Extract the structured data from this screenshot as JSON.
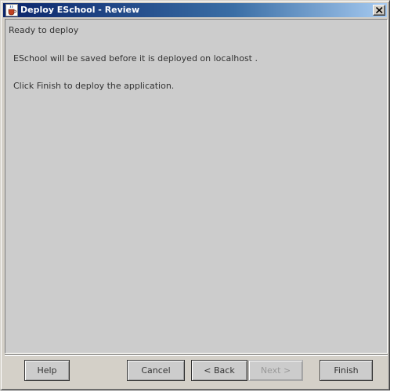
{
  "window": {
    "title": "Deploy ESchool - Review",
    "icon": "java-cup-icon",
    "close_icon": "close-icon"
  },
  "content": {
    "status": "Ready to deploy",
    "message_save": "ESchool will be saved before it is deployed on localhost .",
    "message_finish": "Click  Finish to deploy the application."
  },
  "buttons": {
    "help": "Help",
    "cancel": "Cancel",
    "back": "< Back",
    "next": "Next >",
    "finish": "Finish"
  },
  "colors": {
    "title_bar_start": "#0a246a",
    "title_bar_end": "#a6caf0",
    "panel_background": "#cccccc",
    "window_background": "#d4d0c8",
    "disabled_text": "#999999"
  }
}
